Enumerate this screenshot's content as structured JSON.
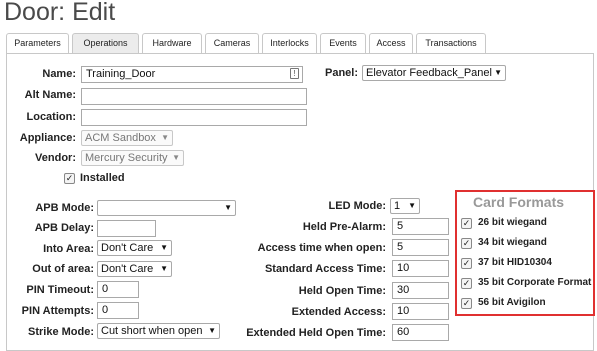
{
  "page": {
    "title": "Door: Edit"
  },
  "tabs": [
    "Parameters",
    "Operations",
    "Hardware",
    "Cameras",
    "Interlocks",
    "Events",
    "Access",
    "Transactions"
  ],
  "active_tab": "Operations",
  "form": {
    "name": {
      "label": "Name:",
      "value": "Training_Door"
    },
    "alt_name": {
      "label": "Alt Name:",
      "value": ""
    },
    "location": {
      "label": "Location:",
      "value": ""
    },
    "appliance": {
      "label": "Appliance:",
      "value": "ACM Sandbox"
    },
    "vendor": {
      "label": "Vendor:",
      "value": "Mercury Security"
    },
    "installed": {
      "label": "Installed",
      "checked": true
    },
    "panel": {
      "label": "Panel:",
      "value": "Elevator Feedback_Panel"
    },
    "apb_mode": {
      "label": "APB Mode:",
      "value": ""
    },
    "apb_delay": {
      "label": "APB Delay:",
      "value": ""
    },
    "into_area": {
      "label": "Into Area:",
      "value": "Don't Care"
    },
    "out_of_area": {
      "label": "Out of area:",
      "value": "Don't Care"
    },
    "pin_timeout": {
      "label": "PIN Timeout:",
      "value": "0"
    },
    "pin_attempts": {
      "label": "PIN Attempts:",
      "value": "0"
    },
    "strike_mode": {
      "label": "Strike Mode:",
      "value": "Cut short when open"
    },
    "led_mode": {
      "label": "LED Mode:",
      "value": "1"
    },
    "held_prealarm": {
      "label": "Held Pre-Alarm:",
      "value": "5"
    },
    "access_time_open": {
      "label": "Access time when open:",
      "value": "5"
    },
    "standard_access_time": {
      "label": "Standard Access Time:",
      "value": "10"
    },
    "held_open_time": {
      "label": "Held Open Time:",
      "value": "30"
    },
    "extended_access": {
      "label": "Extended Access:",
      "value": "10"
    },
    "extended_held_open_time": {
      "label": "Extended Held Open Time:",
      "value": "60"
    }
  },
  "card_formats": {
    "title": "Card Formats",
    "items": [
      {
        "label": "26 bit wiegand",
        "checked": true
      },
      {
        "label": "34 bit wiegand",
        "checked": true
      },
      {
        "label": "37 bit HID10304",
        "checked": true
      },
      {
        "label": "35 bit Corporate Format",
        "checked": true
      },
      {
        "label": "56 bit Avigilon",
        "checked": true
      }
    ]
  },
  "colors": {
    "highlight_border": "#e03030",
    "card_formats_title": "#999999"
  }
}
